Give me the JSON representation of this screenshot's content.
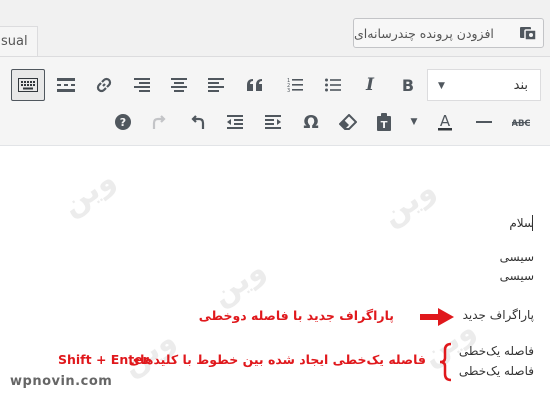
{
  "tabs": {
    "visual_label": "sual"
  },
  "media_button": {
    "label": "افزودن پرونده چندرسانه‌ای",
    "icon": "media-icon"
  },
  "toolbar": {
    "format_select_value": "بند",
    "row1_icons": [
      "toolbar-toggle-icon",
      "read-more-icon",
      "link-icon",
      "align-right-icon",
      "align-center-icon",
      "align-left-icon",
      "blockquote-icon",
      "numbered-list-icon",
      "bulleted-list-icon",
      "italic-icon",
      "bold-icon"
    ],
    "row2_icons": [
      "help-icon",
      "redo-icon",
      "undo-icon",
      "outdent-icon",
      "indent-icon",
      "special-character-icon",
      "clear-formatting-icon",
      "paste-as-text-icon",
      "text-color-icon",
      "horizontal-line-icon",
      "strikethrough-icon"
    ]
  },
  "content": {
    "line1": "سلام",
    "line2": "سیسی",
    "line3": "سیسی",
    "line4": "پاراگراف جدید",
    "line5": "فاصله یک‌خطی",
    "line6": "فاصله یک‌خطی"
  },
  "annotations": {
    "paragraph_note": "پاراگراف جدید با فاصله دوخطی",
    "linebreak_note": "فاصله یک‌خطی ایجاد شده بین خطوط با کلیدهای",
    "shortcut": "Shift + Enter",
    "arrow_color": "#e0181c"
  },
  "watermark": {
    "site": "wpnovin.com",
    "bg_word": "وین"
  }
}
